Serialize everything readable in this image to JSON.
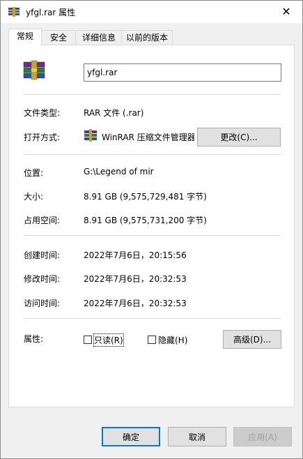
{
  "window": {
    "title": "yfgl.rar 属性",
    "close_glyph": "✕"
  },
  "tabs": [
    {
      "label": "常规"
    },
    {
      "label": "安全"
    },
    {
      "label": "详细信息"
    },
    {
      "label": "以前的版本"
    }
  ],
  "general": {
    "file_name": "yfgl.rar",
    "file_type_label": "文件类型:",
    "file_type_value": "RAR 文件 (.rar)",
    "open_with_label": "打开方式:",
    "open_with_value": "WinRAR 压缩文件管理器",
    "change_button": "更改(C)...",
    "location_label": "位置:",
    "location_value": "G:\\Legend of mir",
    "size_label": "大小:",
    "size_value": "8.91 GB (9,575,729,481 字节)",
    "size_on_disk_label": "占用空间:",
    "size_on_disk_value": "8.91 GB (9,575,731,200 字节)",
    "created_label": "创建时间:",
    "created_value": "2022年7月6日，20:15:56",
    "modified_label": "修改时间:",
    "modified_value": "2022年7月6日，20:32:53",
    "accessed_label": "访问时间:",
    "accessed_value": "2022年7月6日，20:32:53",
    "attributes_label": "属性:",
    "readonly_label": "只读(R)",
    "hidden_label": "隐藏(H)",
    "advanced_button": "高级(D)..."
  },
  "footer": {
    "ok": "确定",
    "cancel": "取消",
    "apply": "应用(A)"
  },
  "colors": {
    "accent": "#0078d7",
    "panel_bg": "#ffffff",
    "window_bg": "#f0f0f0"
  }
}
